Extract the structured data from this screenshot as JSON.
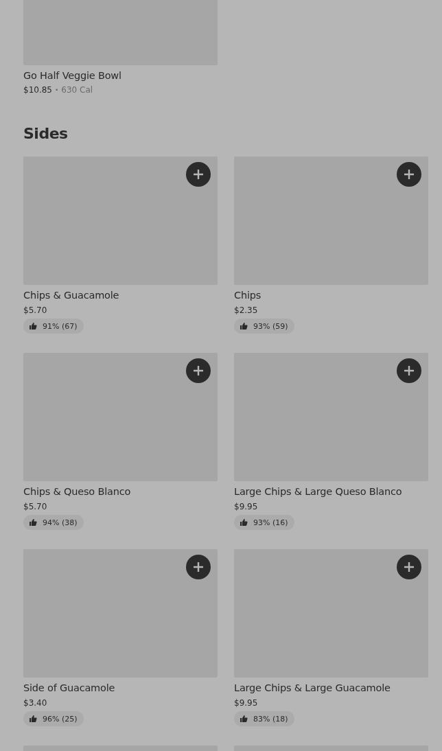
{
  "previous_item": {
    "name": "Go Half Veggie Bowl",
    "price": "$10.85",
    "separator": "•",
    "calories": "630 Cal"
  },
  "section": {
    "title": "Sides",
    "items": [
      {
        "kind": "full",
        "name": "Chips & Guacamole",
        "price": "$5.70",
        "rating": "91% (67)"
      },
      {
        "kind": "full",
        "name": "Chips",
        "price": "$2.35",
        "rating": "93% (59)"
      },
      {
        "kind": "full",
        "name": "Chips & Queso Blanco",
        "price": "$5.70",
        "rating": "94% (38)"
      },
      {
        "kind": "full",
        "name": "Large Chips & Large Queso Blanco",
        "price": "$9.95",
        "rating": "93% (16)"
      },
      {
        "kind": "full",
        "name": "Side of Guacamole",
        "price": "$3.40",
        "rating": "96% (25)"
      },
      {
        "kind": "full",
        "name": "Large Chips & Large Guacamole",
        "price": "$9.95",
        "rating": "83% (18)"
      },
      {
        "kind": "cut"
      },
      {
        "kind": "cut"
      }
    ]
  }
}
